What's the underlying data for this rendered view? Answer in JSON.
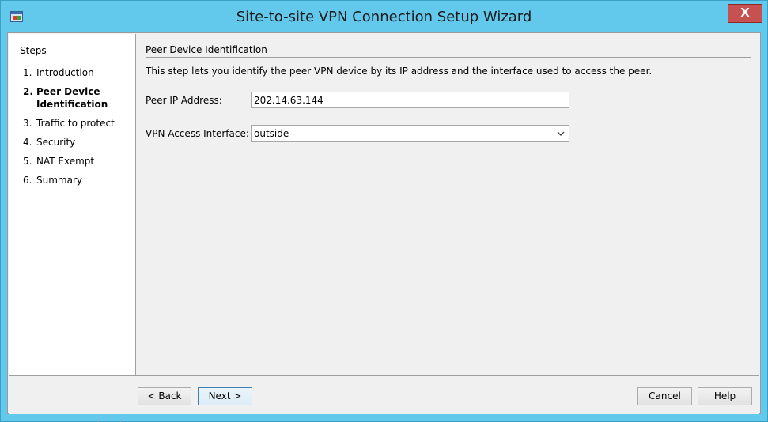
{
  "window": {
    "title": "Site-to-site VPN Connection Setup Wizard",
    "close_glyph": "X"
  },
  "steps": {
    "heading": "Steps",
    "items": [
      {
        "number": "1.",
        "label": "Introduction",
        "active": false
      },
      {
        "number": "2.",
        "label": "Peer Device\nIdentification",
        "active": true
      },
      {
        "number": "3.",
        "label": "Traffic to protect",
        "active": false
      },
      {
        "number": "4.",
        "label": "Security",
        "active": false
      },
      {
        "number": "5.",
        "label": "NAT Exempt",
        "active": false
      },
      {
        "number": "6.",
        "label": "Summary",
        "active": false
      }
    ]
  },
  "main": {
    "section_title": "Peer Device Identification",
    "description": "This step lets you identify the peer VPN device by its IP address and the interface used to access the peer.",
    "peer_ip": {
      "label": "Peer IP Address:",
      "value": "202.14.63.144"
    },
    "vpn_interface": {
      "label": "VPN Access Interface:",
      "value": "outside"
    }
  },
  "buttons": {
    "back": "< Back",
    "next": "Next >",
    "cancel": "Cancel",
    "help": "Help"
  },
  "colors": {
    "titlebar": "#62c9ec",
    "close": "#c75050",
    "panel": "#f0f0f0"
  },
  "icons": {
    "app": "vpn-app-icon",
    "dropdown": "chevron-down-icon"
  }
}
